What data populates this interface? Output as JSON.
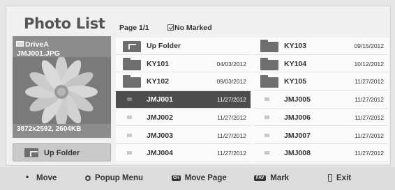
{
  "header": {
    "title": "Photo List",
    "page": "Page 1/1",
    "marked": "No Marked"
  },
  "preview": {
    "drive": "DriveA",
    "filename": "JMJ001.JPG",
    "dimensions": "3872x2592, 2604KB"
  },
  "up_folder_button": {
    "label": "Up Folder"
  },
  "list": {
    "left": [
      {
        "name": "Up Folder",
        "date": "",
        "type": "up"
      },
      {
        "name": "KY101",
        "date": "04/03/2012",
        "type": "folder"
      },
      {
        "name": "KY102",
        "date": "09/03/2012",
        "type": "folder"
      },
      {
        "name": "JMJ001",
        "date": "11/27/2012",
        "type": "photo",
        "selected": true
      },
      {
        "name": "JMJ002",
        "date": "11/27/2012",
        "type": "photo"
      },
      {
        "name": "JMJ003",
        "date": "11/27/2012",
        "type": "photo"
      },
      {
        "name": "JMJ004",
        "date": "11/27/2012",
        "type": "photo"
      }
    ],
    "right": [
      {
        "name": "KY103",
        "date": "09/15/2012",
        "type": "folder"
      },
      {
        "name": "KY104",
        "date": "10/12/2012",
        "type": "folder"
      },
      {
        "name": "KY105",
        "date": "11/27/2012",
        "type": "folder"
      },
      {
        "name": "JMJ005",
        "date": "11/27/2012",
        "type": "photo"
      },
      {
        "name": "JMJ006",
        "date": "11/27/2012",
        "type": "photo"
      },
      {
        "name": "JMJ007",
        "date": "11/27/2012",
        "type": "photo"
      },
      {
        "name": "JMJ008",
        "date": "11/27/2012",
        "type": "photo"
      }
    ]
  },
  "bottom_bar": {
    "move": "Move",
    "popup": "Popup Menu",
    "ch_key": "CH",
    "move_page": "Move Page",
    "fav_key": "FAV",
    "mark": "Mark",
    "exit": "Exit"
  }
}
